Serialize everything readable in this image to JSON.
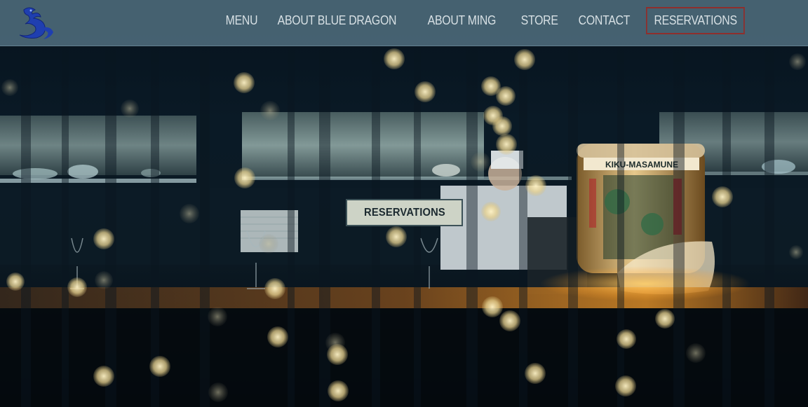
{
  "header": {
    "logo_icon": "blue-dragon-logo",
    "nav": [
      {
        "id": "menu",
        "label": "MENU"
      },
      {
        "id": "about-blue-dragon",
        "label": "ABOUT BLUE DRAGON"
      },
      {
        "id": "about-ming",
        "label": "ABOUT MING"
      },
      {
        "id": "store",
        "label": "STORE"
      },
      {
        "id": "contact",
        "label": "CONTACT"
      },
      {
        "id": "reservations",
        "label": "RESERVATIONS",
        "active": true
      }
    ]
  },
  "hero": {
    "background": "restaurant-kitchen-bokeh-photo",
    "sake_barrel_label": "KIKU-MASAMUNE",
    "cta_label": "RESERVATIONS"
  },
  "colors": {
    "header_bg": "#4e6c7c",
    "nav_text": "#d7e0e4",
    "active_border": "#8f2e2c",
    "cta_bg": "#cdd3c6",
    "cta_border": "#3d5258",
    "logo_blue": "#1f3fb0"
  }
}
